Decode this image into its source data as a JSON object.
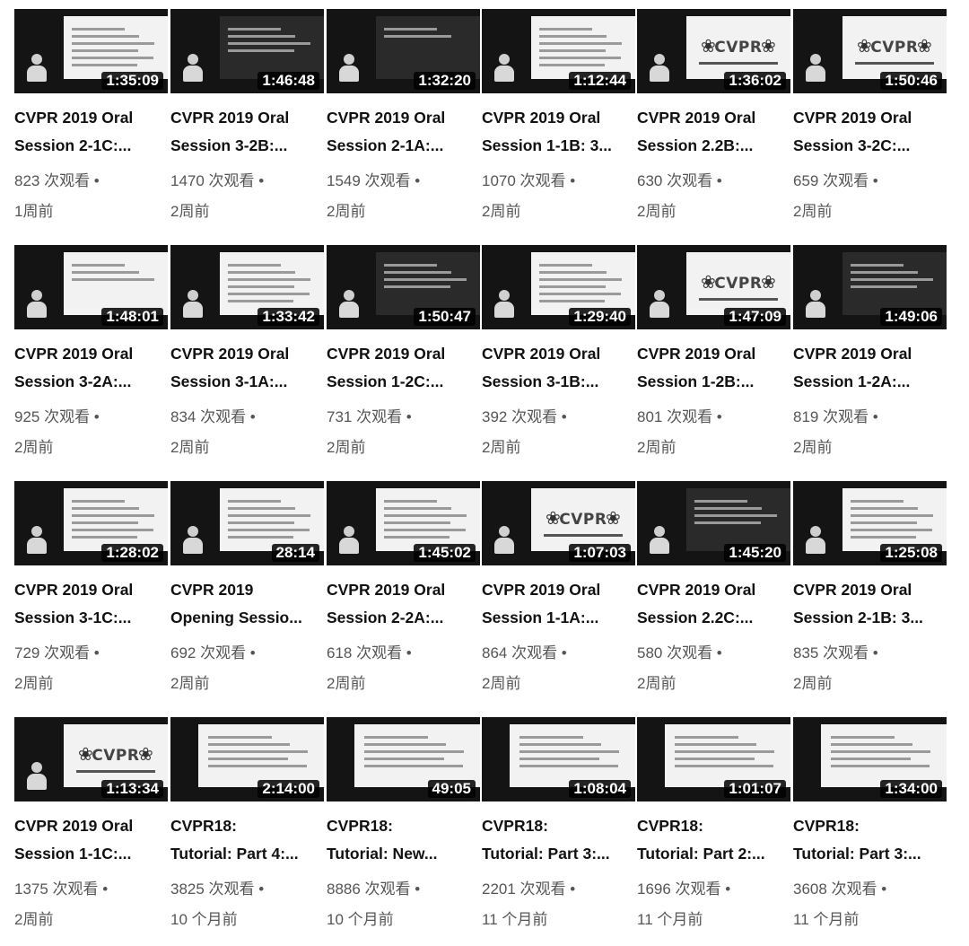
{
  "videos": [
    {
      "title1": "CVPR 2019 Oral",
      "title2": "Session 2-1C:...",
      "duration": "1:35:09",
      "views": "823 次观看 •",
      "age": "1周前",
      "thumb": "slide-table"
    },
    {
      "title1": "CVPR 2019 Oral",
      "title2": "Session 3-2B:...",
      "duration": "1:46:48",
      "views": "1470 次观看 •",
      "age": "2周前",
      "thumb": "dark-grid"
    },
    {
      "title1": "CVPR 2019 Oral",
      "title2": "Session 2-1A:...",
      "duration": "1:32:20",
      "views": "1549 次观看 •",
      "age": "2周前",
      "thumb": "dark-title"
    },
    {
      "title1": "CVPR 2019 Oral",
      "title2": "Session 1-1B: 3...",
      "duration": "1:12:44",
      "views": "1070 次观看 •",
      "age": "2周前",
      "thumb": "slide-text"
    },
    {
      "title1": "CVPR 2019 Oral",
      "title2": "Session 2.2B:...",
      "duration": "1:36:02",
      "views": "630 次观看 •",
      "age": "2周前",
      "thumb": "cvpr-logo"
    },
    {
      "title1": "CVPR 2019 Oral",
      "title2": "Session 3-2C:...",
      "duration": "1:50:46",
      "views": "659 次观看 •",
      "age": "2周前",
      "thumb": "cvpr-logo"
    },
    {
      "title1": "CVPR 2019 Oral",
      "title2": "Session 3-2A:...",
      "duration": "1:48:01",
      "views": "925 次观看 •",
      "age": "2周前",
      "thumb": "slide-title"
    },
    {
      "title1": "CVPR 2019 Oral",
      "title2": "Session 3-1A:...",
      "duration": "1:33:42",
      "views": "834 次观看 •",
      "age": "2周前",
      "thumb": "slide-text"
    },
    {
      "title1": "CVPR 2019 Oral",
      "title2": "Session 1-2C:...",
      "duration": "1:50:47",
      "views": "731 次观看 •",
      "age": "2周前",
      "thumb": "dark-diagram"
    },
    {
      "title1": "CVPR 2019 Oral",
      "title2": "Session 3-1B:...",
      "duration": "1:29:40",
      "views": "392 次观看 •",
      "age": "2周前",
      "thumb": "slide-noise"
    },
    {
      "title1": "CVPR 2019 Oral",
      "title2": "Session 1-2B:...",
      "duration": "1:47:09",
      "views": "801 次观看 •",
      "age": "2周前",
      "thumb": "cvpr-logo"
    },
    {
      "title1": "CVPR 2019 Oral",
      "title2": "Session 1-2A:...",
      "duration": "1:49:06",
      "views": "819 次观看 •",
      "age": "2周前",
      "thumb": "dark-diagram"
    },
    {
      "title1": "CVPR 2019 Oral",
      "title2": "Session 3-1C:...",
      "duration": "1:28:02",
      "views": "729 次观看 •",
      "age": "2周前",
      "thumb": "slide-text"
    },
    {
      "title1": "CVPR 2019",
      "title2": "Opening Sessio...",
      "duration": "28:14",
      "views": "692 次观看 •",
      "age": "2周前",
      "thumb": "slide-chart"
    },
    {
      "title1": "CVPR 2019 Oral",
      "title2": "Session 2-2A:...",
      "duration": "1:45:02",
      "views": "618 次观看 •",
      "age": "2周前",
      "thumb": "slide-text"
    },
    {
      "title1": "CVPR 2019 Oral",
      "title2": "Session 1-1A:...",
      "duration": "1:07:03",
      "views": "864 次观看 •",
      "age": "2周前",
      "thumb": "cvpr-logo"
    },
    {
      "title1": "CVPR 2019 Oral",
      "title2": "Session 2.2C:...",
      "duration": "1:45:20",
      "views": "580 次观看 •",
      "age": "2周前",
      "thumb": "dark-diagram"
    },
    {
      "title1": "CVPR 2019 Oral",
      "title2": "Session 2-1B: 3...",
      "duration": "1:25:08",
      "views": "835 次观看 •",
      "age": "2周前",
      "thumb": "slide-text"
    },
    {
      "title1": "CVPR 2019 Oral",
      "title2": "Session 1-1C:...",
      "duration": "1:13:34",
      "views": "1375 次观看 •",
      "age": "2周前",
      "thumb": "cvpr-logo"
    },
    {
      "title1": "CVPR18:",
      "title2": "Tutorial: Part 4:...",
      "duration": "2:14:00",
      "views": "3825 次观看 •",
      "age": "10 个月前",
      "thumb": "slide-wide"
    },
    {
      "title1": "CVPR18:",
      "title2": "Tutorial: New...",
      "duration": "49:05",
      "views": "8886 次观看 •",
      "age": "10 个月前",
      "thumb": "slide-wide"
    },
    {
      "title1": "CVPR18:",
      "title2": "Tutorial: Part 3:...",
      "duration": "1:08:04",
      "views": "2201 次观看 •",
      "age": "11 个月前",
      "thumb": "slide-wide"
    },
    {
      "title1": "CVPR18:",
      "title2": "Tutorial: Part 2:...",
      "duration": "1:01:07",
      "views": "1696 次观看 •",
      "age": "11 个月前",
      "thumb": "slide-wide"
    },
    {
      "title1": "CVPR18:",
      "title2": "Tutorial: Part 3:...",
      "duration": "1:34:00",
      "views": "3608 次观看 •",
      "age": "11 个月前",
      "thumb": "slide-wide"
    }
  ]
}
